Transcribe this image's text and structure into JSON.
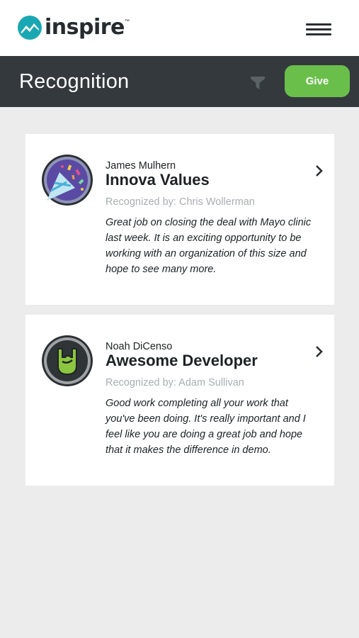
{
  "app": {
    "logo_text": "inspire",
    "logo_tm": "™"
  },
  "header": {
    "title": "Recognition",
    "give_label": "Give"
  },
  "icons": {
    "logo": "mountain-logo-icon",
    "menu": "hamburger-menu-icon",
    "filter": "filter-icon",
    "chevron": "chevron-right-icon"
  },
  "colors": {
    "brand_teal": "#1aa7b4",
    "header_dark": "#33393d",
    "give_green": "#6abf4b",
    "muted_text": "#a9aeb1"
  },
  "recognitions": [
    {
      "recipient": "James Mulhern",
      "award": "Innova Values",
      "recognized_by": "Recognized by: Chris Wollerman",
      "message": "Great job on closing the deal with Mayo clinic last week. It is an exciting opportunity to be working with an organization of this size and hope to see many more.",
      "badge_icon": "party-hat-confetti-icon"
    },
    {
      "recipient": "Noah DiCenso",
      "award": "Awesome Developer",
      "recognized_by": "Recognized by: Adam Sullivan",
      "message": "Good work completing all your work that you've been doing. It's really important and I feel like you are doing a great job and hope that it makes the difference in demo.",
      "badge_icon": "rock-hand-icon"
    }
  ]
}
